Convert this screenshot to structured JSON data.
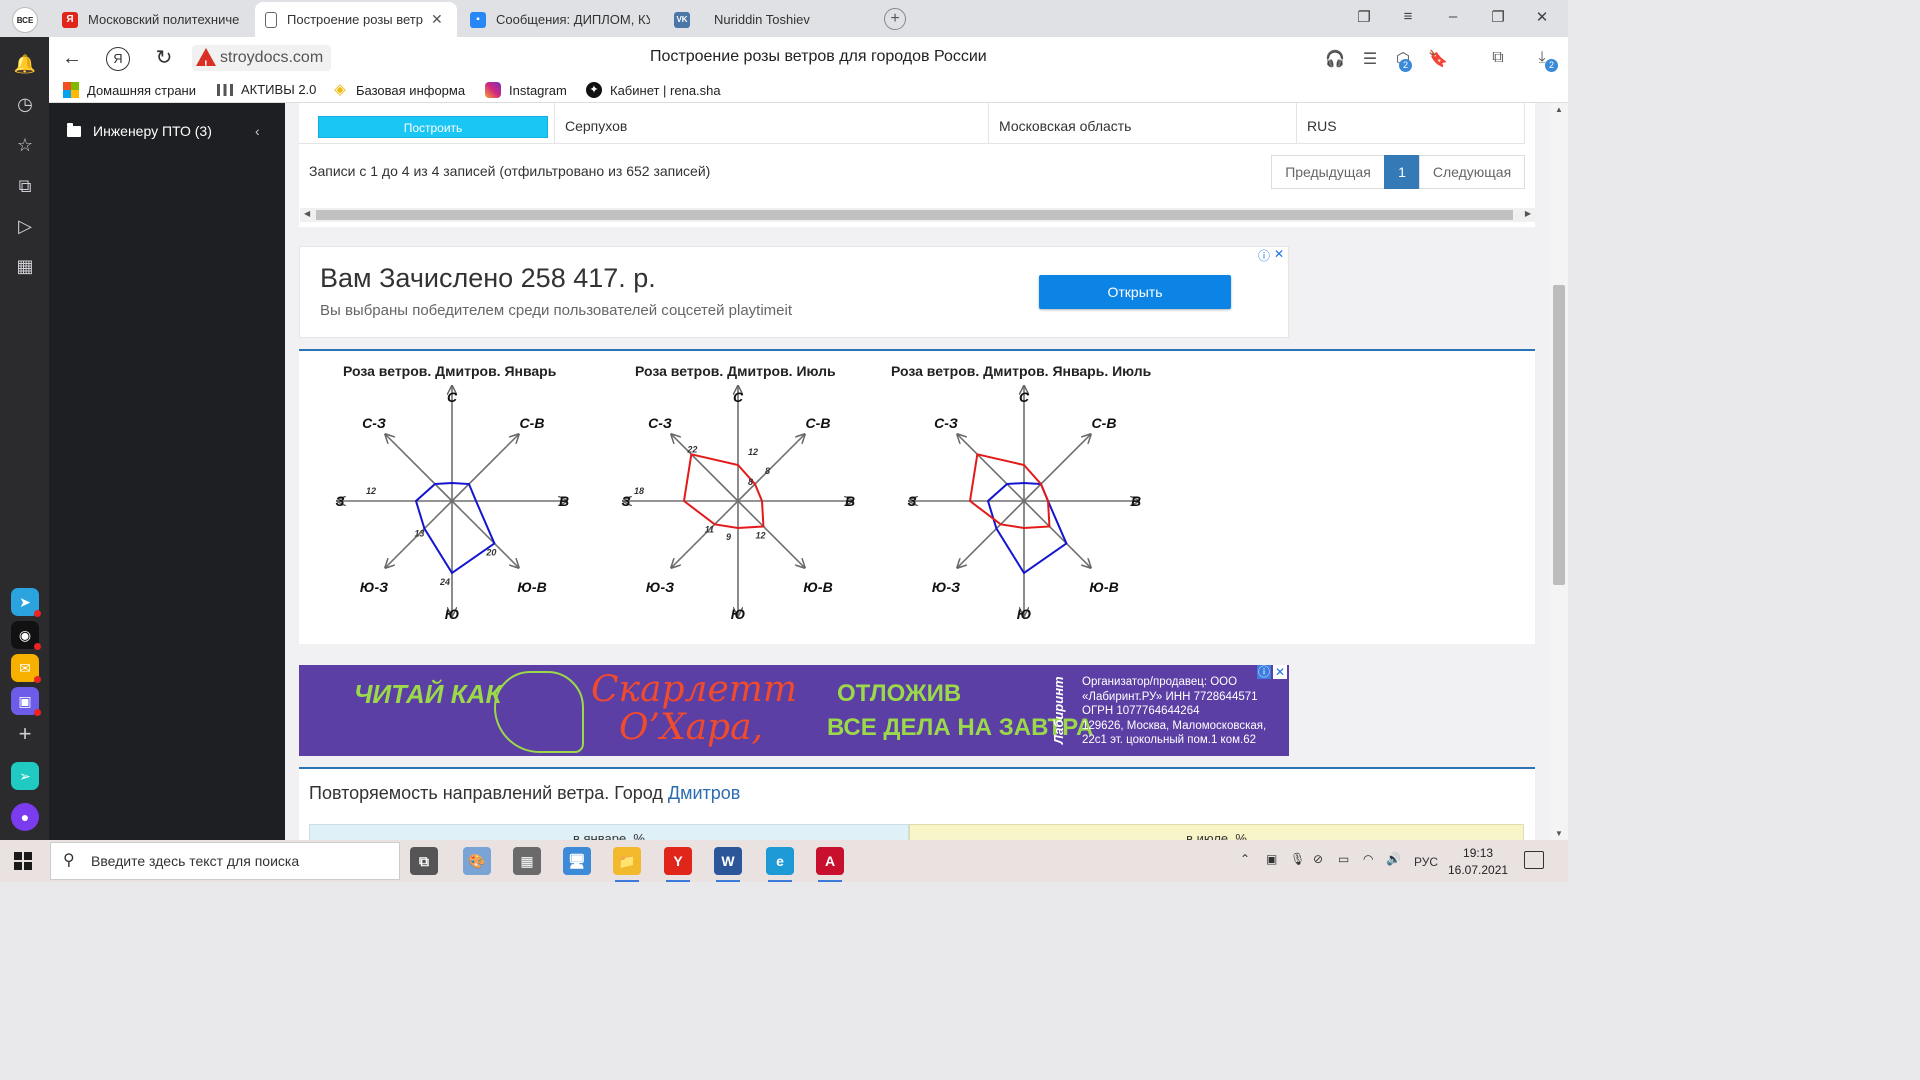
{
  "browser": {
    "brand_logo": "ВСЕ",
    "tabs": [
      {
        "label": "Московский политехниче",
        "favicon": "Я",
        "color": "#e0251b"
      },
      {
        "label": "Построение розы ветр",
        "favicon": "doc",
        "color": "#888888",
        "active": true
      },
      {
        "label": "Сообщения: ДИПЛОМ, КУ",
        "favicon": "msg",
        "color": "#2787f5"
      },
      {
        "label": "Nuriddin Toshiev",
        "favicon": "VK",
        "color": "#4a76a8"
      }
    ],
    "address": "stroydocs.com",
    "page_title": "Построение розы ветров для городов России",
    "downloads_badge": "2",
    "extension_badge": "2",
    "bookmarks": [
      {
        "label": "Домашняя страни",
        "icon": "windows-logo-icon"
      },
      {
        "label": "АКТИВЫ 2.0",
        "icon": "chart-icon"
      },
      {
        "label": "Базовая информа",
        "icon": "binance-icon"
      },
      {
        "label": "Instagram",
        "icon": "instagram-icon"
      },
      {
        "label": "Кабинет | rena.sha",
        "icon": "star-icon"
      }
    ]
  },
  "sidebar": {
    "folder_label": "Инженеру ПТО (3)"
  },
  "table_row": {
    "button_label": "Построить",
    "city": "Серпухов",
    "region": "Московская область",
    "country": "RUS"
  },
  "pagination": {
    "records_text": "Записи с 1 до 4 из 4 записей (отфильтровано из 652 записей)",
    "prev": "Предыдущая",
    "current": "1",
    "next": "Следующая"
  },
  "ad1": {
    "title": "Вам Зачислено 258 417. р.",
    "subtitle": "Вы выбраны победителем среди пользователей соцсетей playtimeit",
    "button": "Открыть"
  },
  "ad2": {
    "left_text": "ЧИТАЙ КАК",
    "brand_line1": "Скарлетт",
    "brand_line2": "О’Хара,",
    "right_line1": "ОТЛОЖИВ",
    "right_line2": "ВСЕ ДЕЛА НА ЗАВТРА",
    "vertical_brand": "Лабиринт",
    "org_lines": [
      "Организатор/продавец: ООО",
      "«Лабиринт.РУ» ИНН 7728644571",
      "ОГРН 1077764644264",
      "129626, Москва, Маломосковская,",
      "22с1 эт. цокольный пом.1 ком.62"
    ]
  },
  "frequency": {
    "title": "Повторяемость направлений ветра. Город",
    "city_link": "Дмитров",
    "col_january": "в январе, %",
    "col_july": "в июле, %"
  },
  "chart_data": [
    {
      "type": "radar",
      "title": "Роза ветров. Дмитров. Январь",
      "axes": [
        "С",
        "С-В",
        "В",
        "Ю-В",
        "Ю",
        "Ю-З",
        "З",
        "С-З"
      ],
      "series": [
        {
          "values": [
            6,
            8,
            8,
            20,
            24,
            13,
            12,
            8
          ],
          "color": "#1515d0"
        }
      ],
      "point_labels": {
        "3": "20",
        "4": "24",
        "5": "13",
        "6": "12"
      }
    },
    {
      "type": "radar",
      "title": "Роза ветров. Дмитров. Июль",
      "axes": [
        "С",
        "С-В",
        "В",
        "Ю-В",
        "Ю",
        "Ю-З",
        "З",
        "С-З"
      ],
      "series": [
        {
          "values": [
            12,
            8,
            8,
            12,
            9,
            11,
            18,
            22
          ],
          "color": "#e31a1a"
        }
      ],
      "point_labels": {
        "0": "12",
        "1": "8",
        "2": "8",
        "3": "12",
        "4": "9",
        "5": "11",
        "6": "18",
        "7": "22"
      }
    },
    {
      "type": "radar",
      "title": "Роза ветров. Дмитров. Январь. Июль",
      "axes": [
        "С",
        "С-В",
        "В",
        "Ю-В",
        "Ю",
        "Ю-З",
        "З",
        "С-З"
      ],
      "series": [
        {
          "values": [
            6,
            8,
            8,
            20,
            24,
            13,
            12,
            8
          ],
          "color": "#1515d0"
        },
        {
          "values": [
            12,
            8,
            8,
            12,
            9,
            11,
            18,
            22
          ],
          "color": "#e31a1a"
        }
      ],
      "point_labels": {}
    }
  ],
  "taskbar": {
    "search_placeholder": "Введите здесь текст для поиска",
    "lang": "РУС",
    "time": "19:13",
    "date": "16.07.2021",
    "apps": [
      {
        "name": "task-view-icon",
        "label": "⧉",
        "color": "#555555"
      },
      {
        "name": "paint-icon",
        "label": "🎨",
        "color": "#7aa4d6"
      },
      {
        "name": "calculator-icon",
        "label": "▦",
        "color": "#6a6a6a"
      },
      {
        "name": "remote-desktop-icon",
        "label": "🖥",
        "color": "#3c8ad8"
      },
      {
        "name": "file-explorer-icon",
        "label": "📁",
        "color": "#f3b92c"
      },
      {
        "name": "yandex-browser-icon",
        "label": "Y",
        "color": "#e0251b"
      },
      {
        "name": "word-icon",
        "label": "W",
        "color": "#2b579a"
      },
      {
        "name": "edge-icon",
        "label": "e",
        "color": "#1d9ad6"
      },
      {
        "name": "autocad-icon",
        "label": "A",
        "color": "#c8102e"
      }
    ]
  }
}
